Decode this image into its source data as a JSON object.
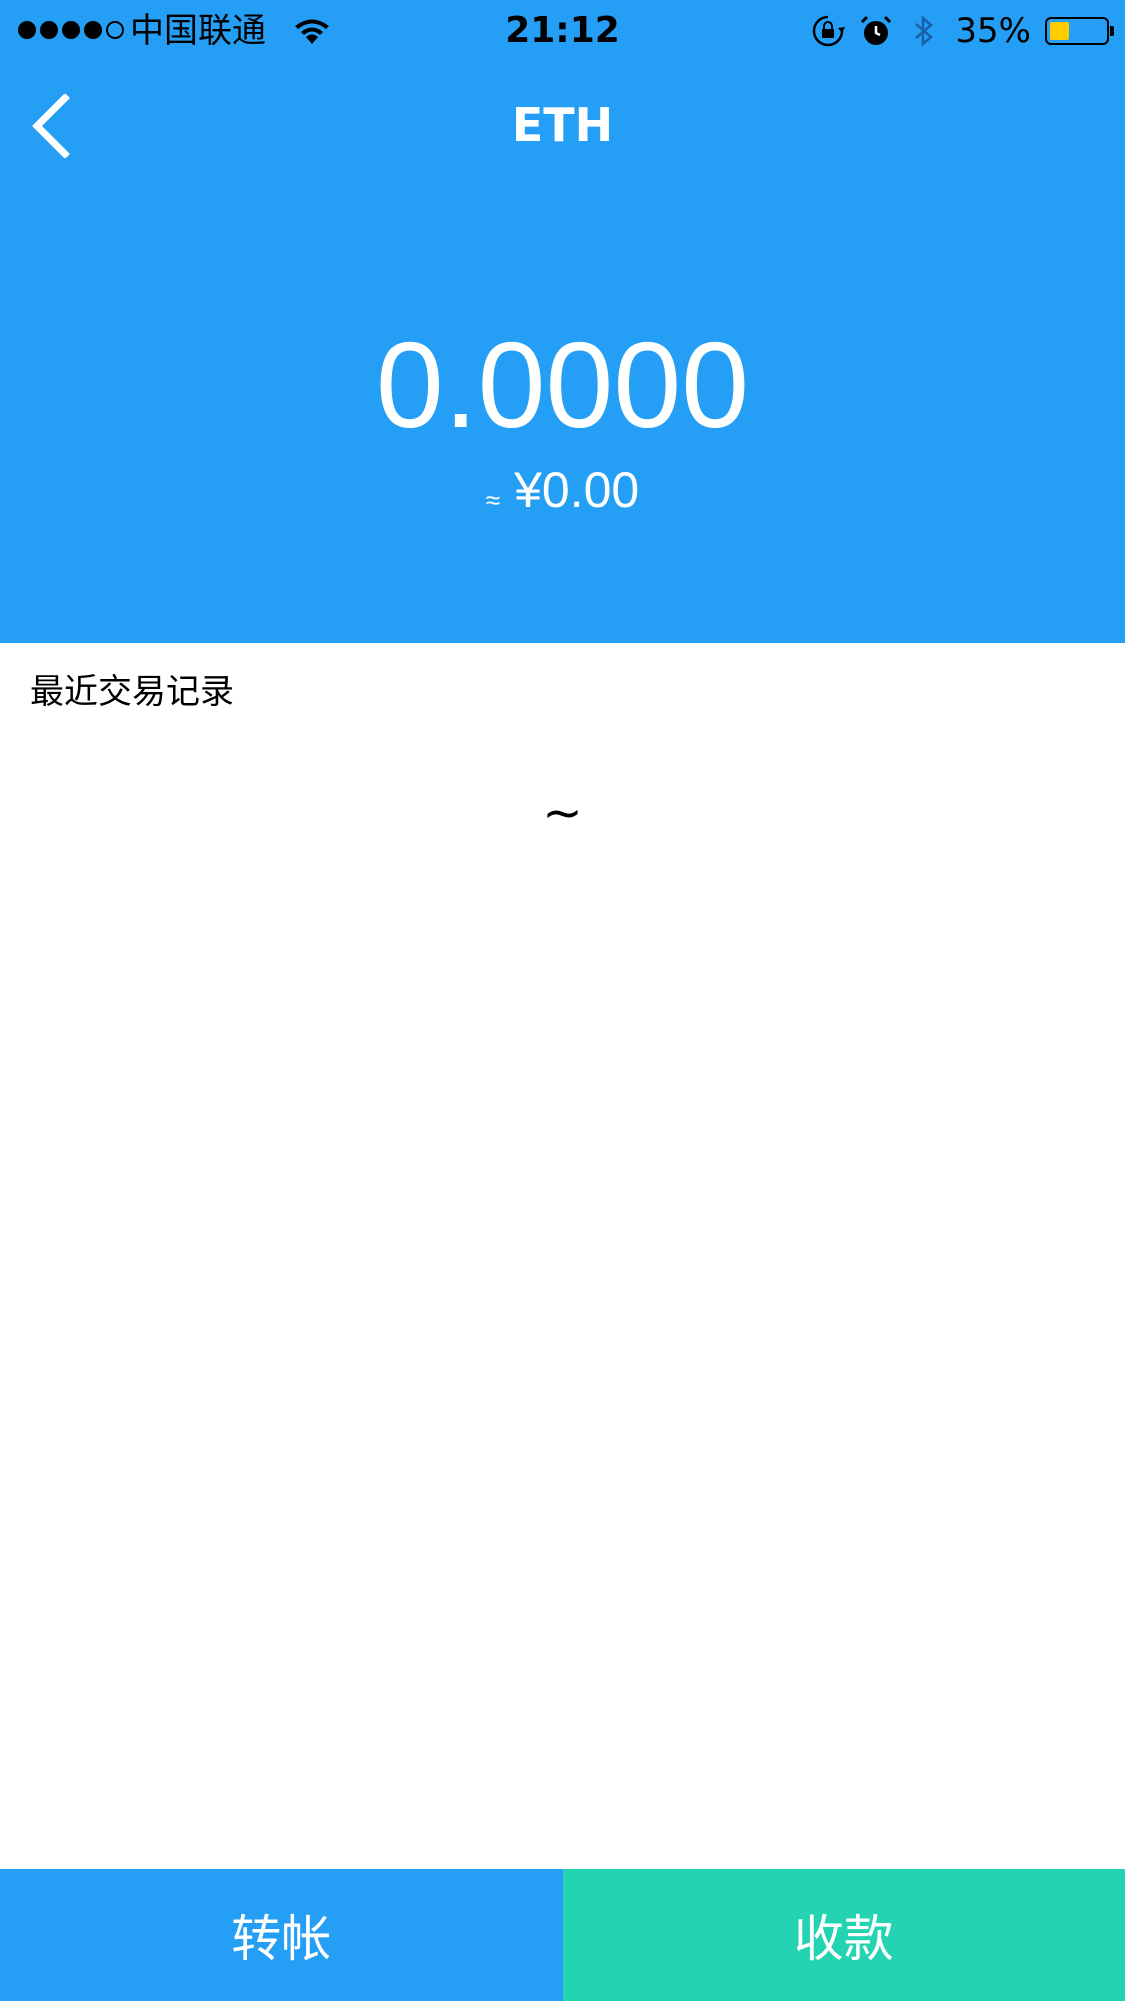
{
  "colors": {
    "header_blue": "#259FF6",
    "receive_green": "#24D3B1",
    "battery_yellow": "#FFCC00"
  },
  "status_bar": {
    "carrier": "中国联通",
    "time": "21:12",
    "battery_percent_text": "35%",
    "battery_level": 0.35,
    "icons": [
      "signal-dots",
      "wifi-icon",
      "orientation-lock-icon",
      "alarm-icon",
      "bluetooth-icon",
      "battery-icon"
    ]
  },
  "nav": {
    "back_icon": "chevron-left-icon",
    "title": "ETH"
  },
  "balance": {
    "amount": "0.0000",
    "approx_symbol": "≈",
    "fiat_value": "¥0.00"
  },
  "transactions": {
    "title": "最近交易记录",
    "empty_text": "~"
  },
  "actions": {
    "transfer_label": "转帐",
    "receive_label": "收款"
  }
}
